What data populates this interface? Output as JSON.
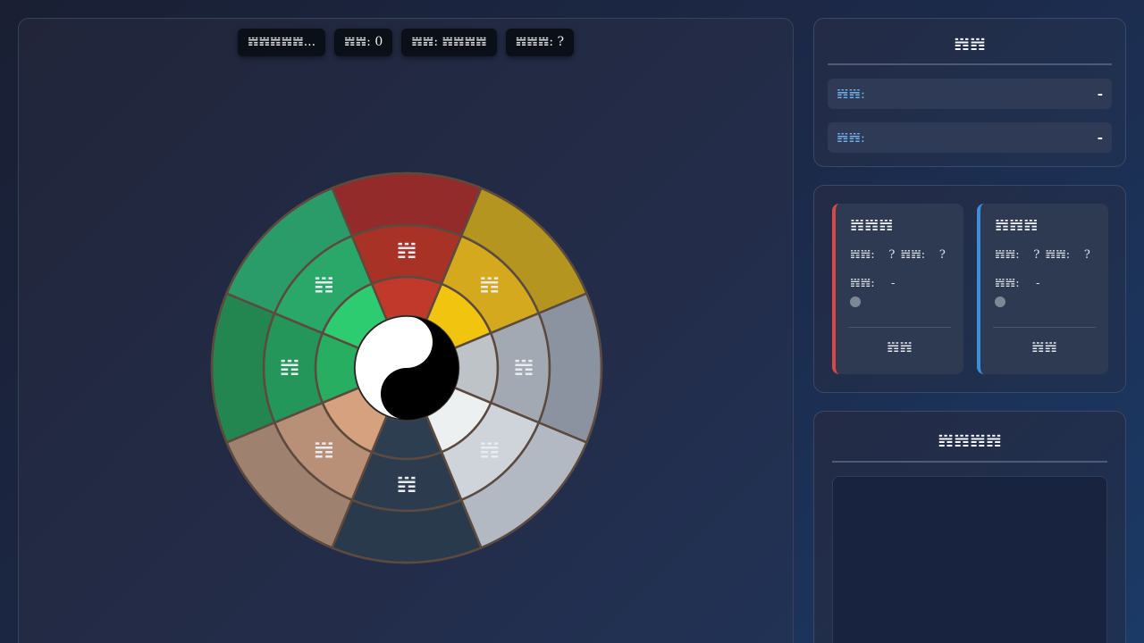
{
  "status": {
    "message": "𝍀𝍀𝍀𝍀𝍀...",
    "turn": "𝍀𝍀: 0",
    "phase": "𝍀𝍀: 𝍀𝍀𝍀𝍀",
    "current": "𝍀𝍀𝍀: ?"
  },
  "info": {
    "title": "𝍀𝍀",
    "rows": [
      {
        "label": "𝍀𝍀:",
        "value": "-"
      },
      {
        "label": "𝍀𝍀:",
        "value": "-"
      }
    ]
  },
  "players": [
    {
      "name": "𝍀𝍀𝍀",
      "stat1_label": "𝍀𝍀:",
      "stat1_value": "?",
      "stat2_label": "𝍀𝍀:",
      "stat2_value": "?",
      "stat3_label": "𝍀𝍀:",
      "stat3_value": "-",
      "action": "𝍀𝍀",
      "accent": "#d94848"
    },
    {
      "name": "𝍀𝍀𝍀",
      "stat1_label": "𝍀𝍀:",
      "stat1_value": "?",
      "stat2_label": "𝍀𝍀:",
      "stat2_value": "?",
      "stat3_label": "𝍀𝍀:",
      "stat3_value": "-",
      "action": "𝍀𝍀",
      "accent": "#3a8fd8"
    }
  ],
  "log": {
    "title": "𝍀𝍀𝍀𝍀"
  },
  "wheel": {
    "segments": [
      {
        "glyph": "𝍀",
        "colors": [
          "#c0392b",
          "#a93227",
          "#922b29"
        ]
      },
      {
        "glyph": "𝍀",
        "colors": [
          "#f1c40f",
          "#d4a91d",
          "#b3951f"
        ]
      },
      {
        "glyph": "𝍀",
        "colors": [
          "#bdc3c7",
          "#a3a9b2",
          "#8b93a0"
        ]
      },
      {
        "glyph": "𝍀",
        "colors": [
          "#ecf0f1",
          "#cfd4db",
          "#b3b9c3"
        ]
      },
      {
        "glyph": "𝍀",
        "colors": [
          "#2c3e50",
          "#2c3b4e",
          "#2a3a4d"
        ]
      },
      {
        "glyph": "𝍀",
        "colors": [
          "#d5a17e",
          "#b89078",
          "#9f8170"
        ]
      },
      {
        "glyph": "𝍀",
        "colors": [
          "#27ae60",
          "#24965a",
          "#238651"
        ]
      },
      {
        "glyph": "𝍀",
        "colors": [
          "#2ecc71",
          "#29a86a",
          "#2a9c6a"
        ]
      }
    ],
    "border_color": "#5c4a3f"
  }
}
